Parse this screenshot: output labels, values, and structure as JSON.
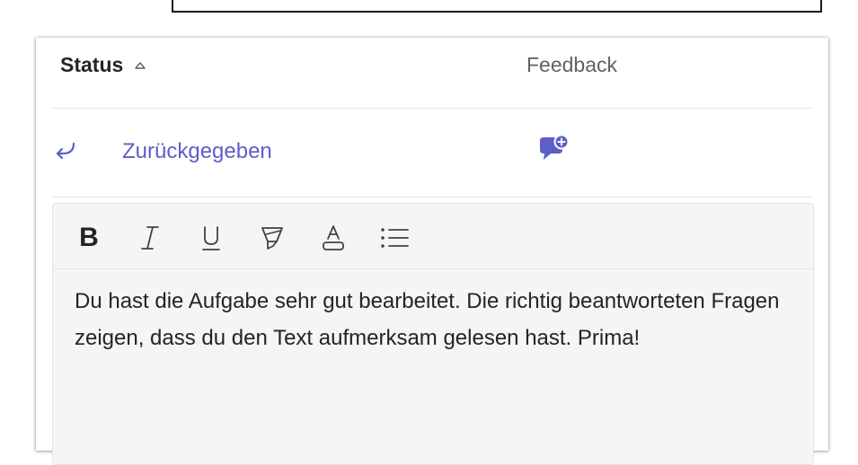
{
  "table": {
    "status_header": "Status",
    "feedback_header": "Feedback"
  },
  "row": {
    "status": "Zurückgegeben",
    "status_icon": "return-arrow-icon",
    "feedback_icon": "comment-add-icon"
  },
  "editor": {
    "toolbar": [
      "bold",
      "italic",
      "underline",
      "highlight",
      "font-color",
      "bulleted-list"
    ],
    "bold_label": "B",
    "text": "Du hast die Aufgabe sehr gut bearbeitet. Die richtig beantworteten Fragen zeigen, dass du den Text aufmerksam gelesen hast. Prima!"
  },
  "colors": {
    "accent": "#5b5fc7",
    "text": "#242424",
    "muted": "#616161",
    "editor_bg": "#f5f5f5"
  }
}
